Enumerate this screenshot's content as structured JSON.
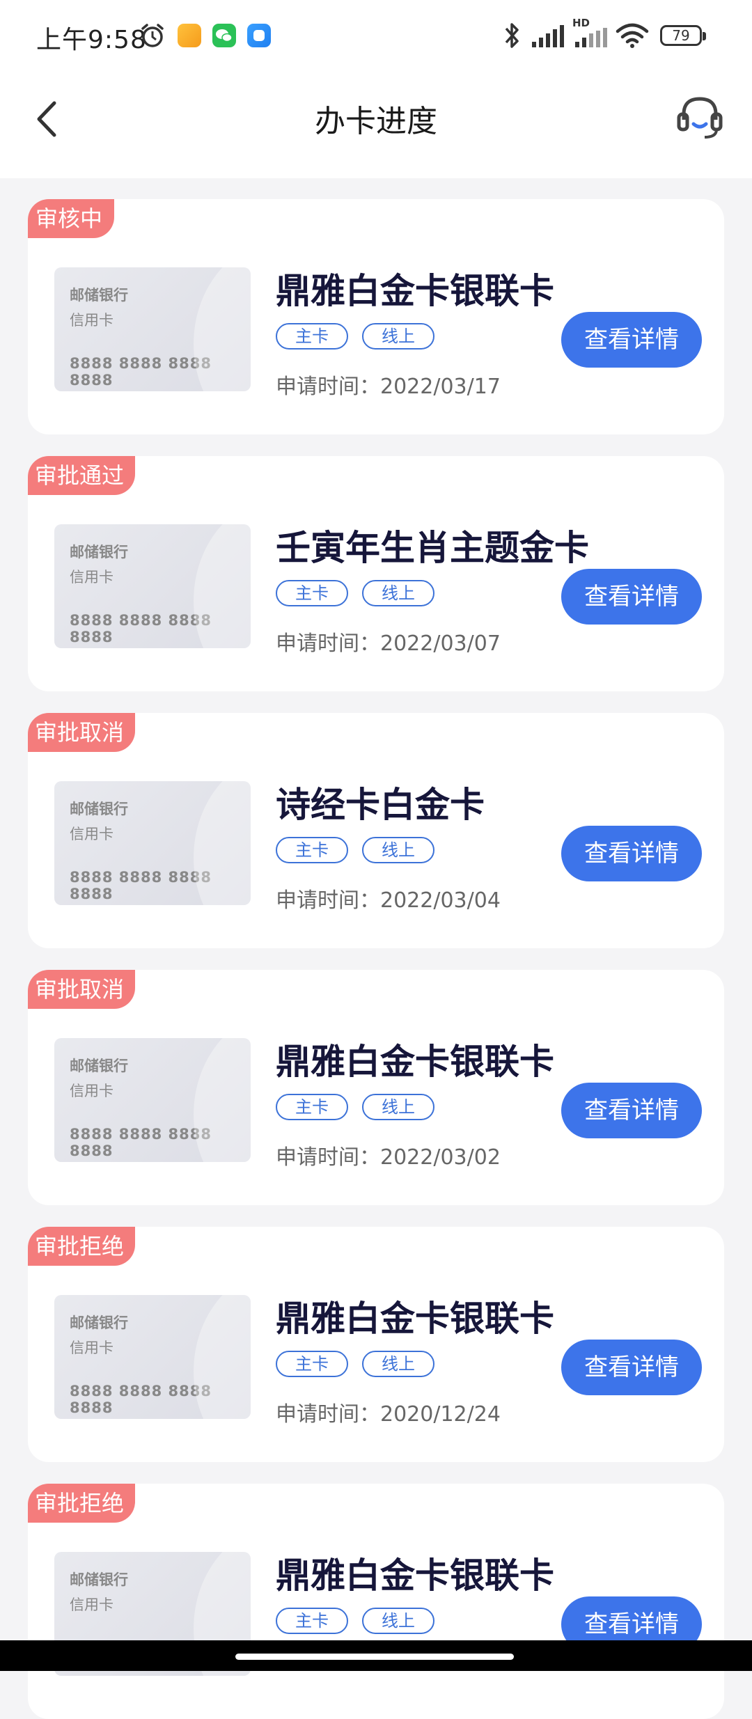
{
  "status_bar": {
    "time": "上午9:58",
    "battery": "79",
    "icons": [
      "alarm-icon",
      "notes-app-icon",
      "wechat-app-icon",
      "app-icon",
      "bluetooth-icon",
      "signal-icon",
      "hd-signal-icon",
      "wifi-icon",
      "battery-icon"
    ],
    "hd_label": "HD"
  },
  "header": {
    "title": "办卡进度",
    "back_icon": "back-arrow-icon",
    "service_icon": "customer-service-icon"
  },
  "card_preview": {
    "bank": "邮储银行",
    "type": "信用卡",
    "number": "8888 8888 8888 8888"
  },
  "colors": {
    "accent": "#3d74ea",
    "status_tag": "#f47c7c",
    "title_text": "#16163a",
    "background": "#f4f4f6"
  },
  "applications": [
    {
      "status": "审核中",
      "name": "鼎雅白金卡银联卡",
      "tags": [
        "主卡",
        "线上"
      ],
      "apply_time": "申请时间：2022/03/17",
      "button": "查看详情"
    },
    {
      "status": "审批通过",
      "name": "壬寅年生肖主题金卡",
      "tags": [
        "主卡",
        "线上"
      ],
      "apply_time": "申请时间：2022/03/07",
      "button": "查看详情"
    },
    {
      "status": "审批取消",
      "name": "诗经卡白金卡",
      "tags": [
        "主卡",
        "线上"
      ],
      "apply_time": "申请时间：2022/03/04",
      "button": "查看详情"
    },
    {
      "status": "审批取消",
      "name": "鼎雅白金卡银联卡",
      "tags": [
        "主卡",
        "线上"
      ],
      "apply_time": "申请时间：2022/03/02",
      "button": "查看详情"
    },
    {
      "status": "审批拒绝",
      "name": "鼎雅白金卡银联卡",
      "tags": [
        "主卡",
        "线上"
      ],
      "apply_time": "申请时间：2020/12/24",
      "button": "查看详情"
    },
    {
      "status": "审批拒绝",
      "name": "鼎雅白金卡银联卡",
      "tags": [
        "主卡",
        "线上"
      ],
      "apply_time": "",
      "button": "查看详情"
    }
  ]
}
